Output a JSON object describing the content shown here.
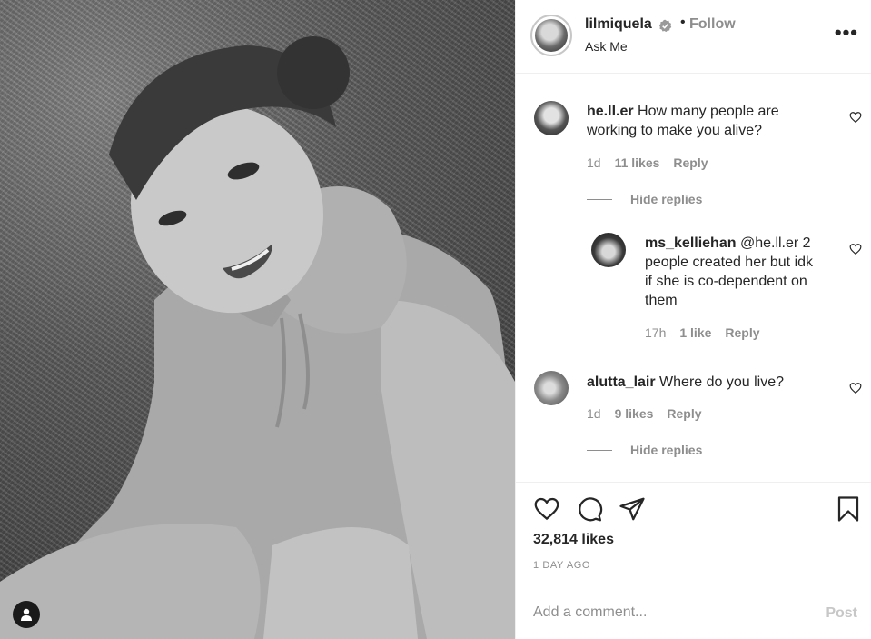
{
  "header": {
    "username": "lilmiquela",
    "dot": "•",
    "follow_label": "Follow",
    "subtitle": "Ask Me",
    "more_icon": "more-options-icon",
    "more_glyph": "•••"
  },
  "comments": [
    {
      "username": "he.ll.er",
      "text": "How many people are working to make you alive?",
      "text_line1": "How many people are",
      "text_line2": "working to make you alive?",
      "time": "1d",
      "likes": "11 likes",
      "reply_label": "Reply",
      "hide_replies_label": "Hide replies"
    },
    {
      "username": "ms_kelliehan",
      "text_line1": "@he.ll.er 2",
      "text_line2": "people created her but idk",
      "text_line3": "if she is co-dependent on",
      "text_line4": "them",
      "time": "17h",
      "likes": "1 like",
      "reply_label": "Reply"
    },
    {
      "username": "alutta_lair",
      "text": "Where do you live?",
      "time": "1d",
      "likes": "9 likes",
      "reply_label": "Reply",
      "hide_replies_label": "Hide replies"
    }
  ],
  "actions": {
    "likes": "32,814 likes",
    "date": "1 DAY AGO"
  },
  "add_comment": {
    "placeholder": "Add a comment...",
    "post_label": "Post"
  },
  "colors": {
    "text": "#262626",
    "muted": "#8e8e8e",
    "border": "#efefef",
    "post_disabled": "#c7c7c7"
  }
}
